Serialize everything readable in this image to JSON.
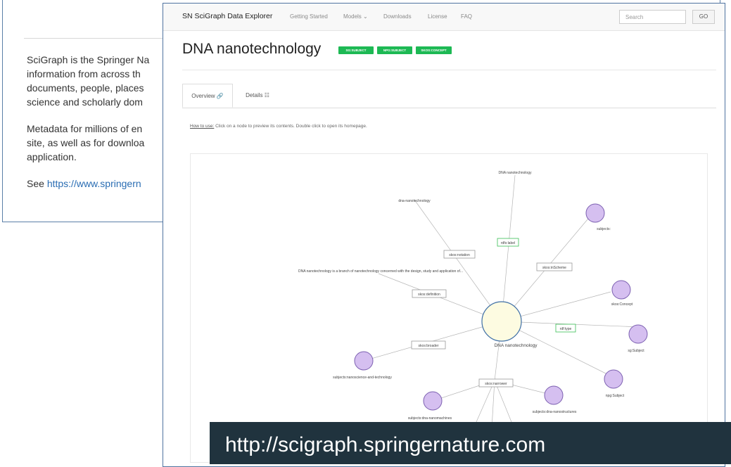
{
  "bg": {
    "para1": "SciGraph is the Springer Nature Linked Open Data platform aggregating information from across the research landscape, e.g. funders, research projects, conferences, affiliations and publications. The knowledge graph contains documents, people, places, organisations, events and other concepts of relevance to the science and scholarly domain.",
    "para1_lines": [
      "SciGraph is the Springer Na",
      "information from across th",
      "documents, people, places",
      "science and scholarly dom"
    ],
    "para2_lines": [
      "Metadata for millions of en",
      "site, as well as for downloa",
      "application."
    ],
    "see_prefix": "See ",
    "see_link": "https://www.springern"
  },
  "navbar": {
    "brand": "SN SciGraph Data Explorer",
    "items": [
      "Getting Started",
      "Models ⌄",
      "Downloads",
      "License",
      "FAQ"
    ],
    "search_placeholder": "Search",
    "go_label": "GO"
  },
  "page": {
    "title": "DNA nanotechnology",
    "badges": [
      "SG:SUBJECT",
      "NPG:SUBJECT",
      "SKOS:CONCEPT"
    ],
    "tabs": [
      "Overview 🔗",
      "Details ☷"
    ],
    "howto_label": "How to use:",
    "howto_text": " Click on a node to preview its contents. Double click to open its homepage."
  },
  "graph": {
    "center": "DNA nanotechnology",
    "edge_labels": [
      "rdfs:label",
      "skos:inScheme",
      "skos:notation",
      "skos:definition",
      "rdf:type",
      "skos:broader",
      "skos:narrower"
    ],
    "literals": [
      "DNA nanotechnology",
      "dna-nanotechnology",
      "DNA nanotechnology is a branch of nanotechnology concerned with the design, study and application of..."
    ],
    "nodes": [
      "subjects:",
      "skos:Concept",
      "sg:Subject",
      "npg:Subject",
      "subjects:nanoscience-and-technology",
      "subjects:dna-nanomachines",
      "subjects:dna-nanostructures"
    ]
  },
  "url_banner": "http://scigraph.springernature.com",
  "colors": {
    "badge": "#1db954",
    "node_fill": "#d5bff0",
    "node_stroke": "#7b5fb0",
    "center_fill": "#fdfbe1",
    "banner_bg": "#20333e"
  }
}
